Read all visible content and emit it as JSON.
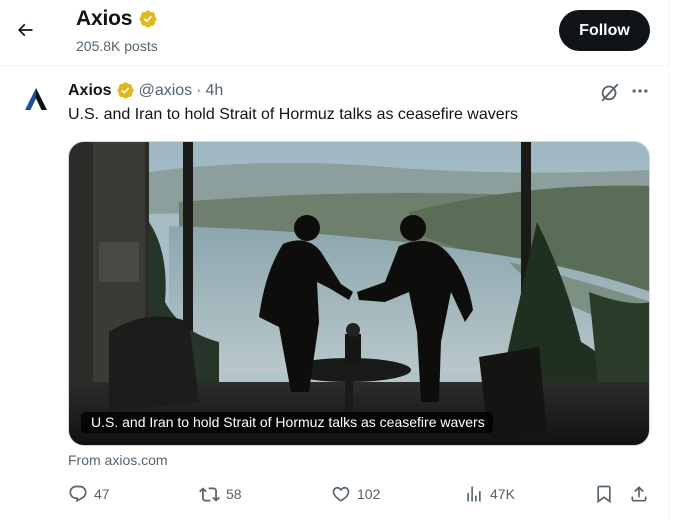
{
  "header": {
    "title": "Axios",
    "post_count": "205.8K posts",
    "follow_label": "Follow"
  },
  "tweet": {
    "author_name": "Axios",
    "handle": "@axios",
    "separator": "·",
    "time": "4h",
    "text": "U.S. and Iran to hold Strait of Hormuz talks as ceasefire wavers",
    "card": {
      "caption": "U.S. and Iran to hold Strait of Hormuz talks as ceasefire wavers",
      "source": "From axios.com"
    },
    "actions": {
      "replies": "47",
      "reposts": "58",
      "likes": "102",
      "views": "47K"
    }
  },
  "colors": {
    "text_primary": "#0f1419",
    "text_secondary": "#536471",
    "verified_gold": "#e2b719",
    "border": "#eff3f4",
    "follow_bg": "#0f1419"
  },
  "icons": [
    "back-arrow-icon",
    "verified-badge-icon",
    "axios-logo-icon",
    "grok-icon",
    "more-icon",
    "reply-icon",
    "repost-icon",
    "like-icon",
    "views-icon",
    "bookmark-icon",
    "share-icon"
  ]
}
